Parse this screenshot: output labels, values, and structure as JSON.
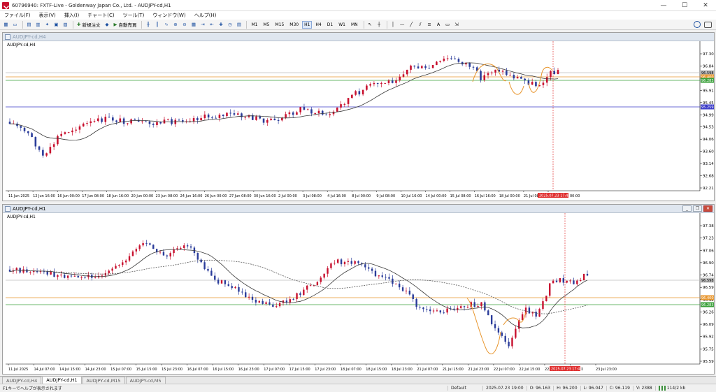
{
  "window": {
    "title": "60796940: FXTF-Live - Goldenway Japan Co., Ltd. - AUDJPY-cd,H1",
    "minimize": "—",
    "maximize": "☐",
    "close": "✕"
  },
  "menu": [
    "ファイル(F)",
    "表示(V)",
    "挿入(I)",
    "チャート(C)",
    "ツール(T)",
    "ウィンドウ(W)",
    "ヘルプ(H)"
  ],
  "toolbar": {
    "new_order": "新規注文",
    "auto_trade": "自動売買",
    "timeframes": [
      "M1",
      "M5",
      "M15",
      "M30",
      "H1",
      "H4",
      "D1",
      "W1",
      "MN"
    ],
    "active_timeframe": "H1"
  },
  "charts": [
    {
      "window_title": "AUDJPY-cd,H4",
      "label": "AUDJPY-cd,H4",
      "window_state": "inactive",
      "price_labels": [
        "97.300",
        "96.840",
        "96.410",
        "95.910",
        "95.450",
        "94.990",
        "94.530",
        "94.060",
        "93.600",
        "93.140",
        "92.680",
        "92.210"
      ],
      "bid_label": "96.598",
      "orange_line_label": "96.400",
      "green_line_label": "96.283",
      "blue_line_label": "95.259",
      "time_labels": [
        "11 Jun 2025",
        "12 Jun 16:00",
        "16 Jun 00:00",
        "17 Jun 08:00",
        "18 Jun 16:00",
        "20 Jun 00:00",
        "23 Jun 08:00",
        "24 Jun 16:00",
        "26 Jun 00:00",
        "27 Jun 08:00",
        "30 Jun 16:00",
        "2 Jul 00:00",
        "3 Jul 08:00",
        "4 Jul 16:00",
        "8 Jul 00:00",
        "9 Jul 08:00",
        "10 Jul 16:00",
        "14 Jul 00:00",
        "15 Jul 08:00",
        "16 Jul 16:00",
        "18 Jul 00:00",
        "21 Jul 08:00",
        "22"
      ],
      "cursor_time_label": "2025.07.23 17:45",
      "cursor_time_suffix": "00:00",
      "price_range": [
        92.21,
        97.53
      ],
      "colors": {
        "bull": "#c8102e",
        "bear": "#2a3c9a",
        "ma": "#3a3a3a",
        "orange": "#e8962e",
        "green": "#3aa03a",
        "blue": "#3a3ac8",
        "cursor": "#e03030"
      }
    },
    {
      "window_title": "AUDJPY-cd,H1",
      "label": "AUDJPY-cd,H1",
      "window_state": "active",
      "price_labels": [
        "97.380",
        "97.230",
        "97.060",
        "96.900",
        "96.740",
        "96.590",
        "96.420",
        "96.260",
        "96.090",
        "95.920",
        "95.750",
        "95.590"
      ],
      "bid_label": "96.598",
      "orange_line_label": "96.400",
      "green_line_label": "96.283",
      "time_labels": [
        "11 Jul 2025",
        "14 Jul 07:00",
        "14 Jul 15:00",
        "14 Jul 23:00",
        "15 Jul 07:00",
        "15 Jul 15:00",
        "15 Jul 23:00",
        "16 Jul 07:00",
        "16 Jul 15:00",
        "16 Jul 23:00",
        "17 Jul 07:00",
        "17 Jul 15:00",
        "17 Jul 23:00",
        "18 Jul 07:00",
        "18 Jul 15:00",
        "18 Jul 23:00",
        "21 Jul 07:00",
        "21 Jul 15:00",
        "21 Jul 23:00",
        "22 Jul 07:00",
        "22 Jul 15:00",
        "22 Jul 23:00",
        "23 Jul 0",
        "23 Jul 23:00"
      ],
      "cursor_time_label": "2025.07.23 17:45",
      "price_range": [
        95.55,
        97.45
      ]
    }
  ],
  "tabs": [
    "AUDJPY-cd,H4",
    "AUDJPY-cd,H1",
    "AUDJPY-cd,M15",
    "AUDJPY-cd,M5"
  ],
  "active_tab": "AUDJPY-cd,H1",
  "status": {
    "help": "F1キーでヘルプが表示されます",
    "profile": "Default",
    "datetime": "2025.07.23 19:00",
    "open": "O: 96.163",
    "high": "H: 96.200",
    "low": "L: 96.047",
    "close": "C: 96.119",
    "volume": "V: 2388",
    "traffic": "114/2 kb"
  }
}
